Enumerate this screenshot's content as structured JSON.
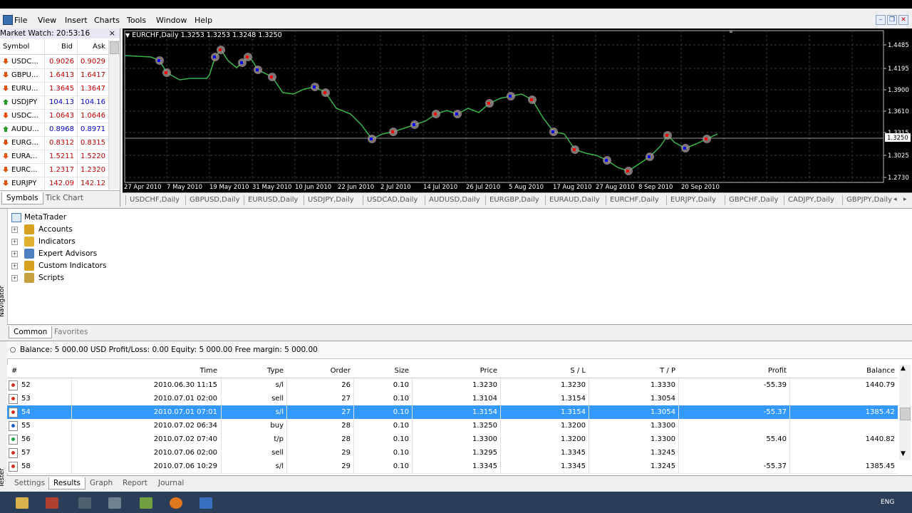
{
  "menu": {
    "items": [
      "File",
      "View",
      "Insert",
      "Charts",
      "Tools",
      "Window",
      "Help"
    ]
  },
  "window_buttons": {
    "minimize": "–",
    "restore": "❐",
    "close": "✕"
  },
  "market_watch": {
    "title": "Market Watch: 20:53:16",
    "close": "×",
    "columns": {
      "symbol": "Symbol",
      "bid": "Bid",
      "ask": "Ask"
    },
    "rows": [
      {
        "symbol": "USDC...",
        "bid": "0.9026",
        "ask": "0.9029",
        "dir": "down",
        "color": "#c00000"
      },
      {
        "symbol": "GBPU...",
        "bid": "1.6413",
        "ask": "1.6417",
        "dir": "down",
        "color": "#c00000"
      },
      {
        "symbol": "EURU...",
        "bid": "1.3645",
        "ask": "1.3647",
        "dir": "down",
        "color": "#c00000"
      },
      {
        "symbol": "USDJPY",
        "bid": "104.13",
        "ask": "104.16",
        "dir": "up",
        "color": "#0000c0"
      },
      {
        "symbol": "USDC...",
        "bid": "1.0643",
        "ask": "1.0646",
        "dir": "down",
        "color": "#c00000"
      },
      {
        "symbol": "AUDU...",
        "bid": "0.8968",
        "ask": "0.8971",
        "dir": "up",
        "color": "#0000c0"
      },
      {
        "symbol": "EURG...",
        "bid": "0.8312",
        "ask": "0.8315",
        "dir": "down",
        "color": "#c00000"
      },
      {
        "symbol": "EURA...",
        "bid": "1.5211",
        "ask": "1.5220",
        "dir": "down",
        "color": "#c00000"
      },
      {
        "symbol": "EURC...",
        "bid": "1.2317",
        "ask": "1.2320",
        "dir": "down",
        "color": "#c00000"
      },
      {
        "symbol": "EURJPY",
        "bid": "142.09",
        "ask": "142.12",
        "dir": "down",
        "color": "#c00000"
      }
    ],
    "tabs": [
      "Symbols",
      "Tick Chart"
    ]
  },
  "chart": {
    "title": "EURCHF,Daily  1.3253 1.3253 1.3248 1.3250",
    "y_ticks": [
      "1.4485",
      "1.4195",
      "1.3900",
      "1.3610",
      "1.3315",
      "1.3025",
      "1.2730"
    ],
    "current_price": "1.3250",
    "x_ticks": [
      "27 Apr 2010",
      "7 May 2010",
      "19 May 2010",
      "31 May 2010",
      "10 Jun 2010",
      "22 Jun 2010",
      "2 Jul 2010",
      "14 Jul 2010",
      "26 Jul 2010",
      "5 Aug 2010",
      "17 Aug 2010",
      "27 Aug 2010",
      "8 Sep 2010",
      "20 Sep 2010"
    ],
    "colors": {
      "background": "#000000",
      "grid": "#3a3a3a",
      "line": "#39b54a",
      "marker": "#a09090",
      "buy": "#0000ff",
      "sell": "#ff0000"
    }
  },
  "chart_tabs": [
    "USDCHF,Daily",
    "GBPUSD,Daily",
    "EURUSD,Daily",
    "USDJPY,Daily",
    "USDCAD,Daily",
    "AUDUSD,Daily",
    "EURGBP,Daily",
    "EURAUD,Daily",
    "EURCHF,Daily",
    "EURJPY,Daily",
    "GBPCHF,Daily",
    "CADJPY,Daily",
    "GBPJPY,Daily"
  ],
  "navigator": {
    "side_label": "Navigator",
    "root": "MetaTrader",
    "items": [
      "Accounts",
      "Indicators",
      "Expert Advisors",
      "Custom Indicators",
      "Scripts"
    ],
    "tabs": [
      "Common",
      "Favorites"
    ]
  },
  "terminal": {
    "side_label": "Tester",
    "balance": "Balance: 5 000.00 USD  Profit/Loss: 0.00  Equity: 5 000.00  Free margin: 5 000.00",
    "columns": [
      "#",
      "Time",
      "Type",
      "Order",
      "Size",
      "Price",
      "S / L",
      "T / P",
      "Profit",
      "Balance"
    ],
    "rows": [
      {
        "n": "52",
        "time": "2010.06.30 11:15",
        "type": "s/l",
        "order": "26",
        "size": "0.10",
        "price": "1.3230",
        "sl": "1.3230",
        "tp": "1.3330",
        "profit": "-55.39",
        "balance": "1440.79",
        "icon": "close"
      },
      {
        "n": "53",
        "time": "2010.07.01 02:00",
        "type": "sell",
        "order": "27",
        "size": "0.10",
        "price": "1.3104",
        "sl": "1.3154",
        "tp": "1.3054",
        "profit": "",
        "balance": "",
        "icon": "sell"
      },
      {
        "n": "54",
        "time": "2010.07.01 07:01",
        "type": "s/l",
        "order": "27",
        "size": "0.10",
        "price": "1.3154",
        "sl": "1.3154",
        "tp": "1.3054",
        "profit": "-55.37",
        "balance": "1385.42",
        "icon": "close"
      },
      {
        "n": "55",
        "time": "2010.07.02 06:34",
        "type": "buy",
        "order": "28",
        "size": "0.10",
        "price": "1.3250",
        "sl": "1.3200",
        "tp": "1.3300",
        "profit": "",
        "balance": "",
        "icon": "buy"
      },
      {
        "n": "56",
        "time": "2010.07.02 07:40",
        "type": "t/p",
        "order": "28",
        "size": "0.10",
        "price": "1.3300",
        "sl": "1.3200",
        "tp": "1.3300",
        "profit": "55.40",
        "balance": "1440.82",
        "icon": "tp"
      },
      {
        "n": "57",
        "time": "2010.07.06 02:00",
        "type": "sell",
        "order": "29",
        "size": "0.10",
        "price": "1.3295",
        "sl": "1.3345",
        "tp": "1.3245",
        "profit": "",
        "balance": "",
        "icon": "sell"
      },
      {
        "n": "58",
        "time": "2010.07.06 10:29",
        "type": "s/l",
        "order": "29",
        "size": "0.10",
        "price": "1.3345",
        "sl": "1.3345",
        "tp": "1.3245",
        "profit": "-55.37",
        "balance": "1385.45",
        "icon": "close"
      }
    ],
    "tabs": [
      "Settings",
      "Results",
      "Graph",
      "Report",
      "Journal"
    ]
  },
  "taskbar": {
    "lang": "ENG"
  }
}
